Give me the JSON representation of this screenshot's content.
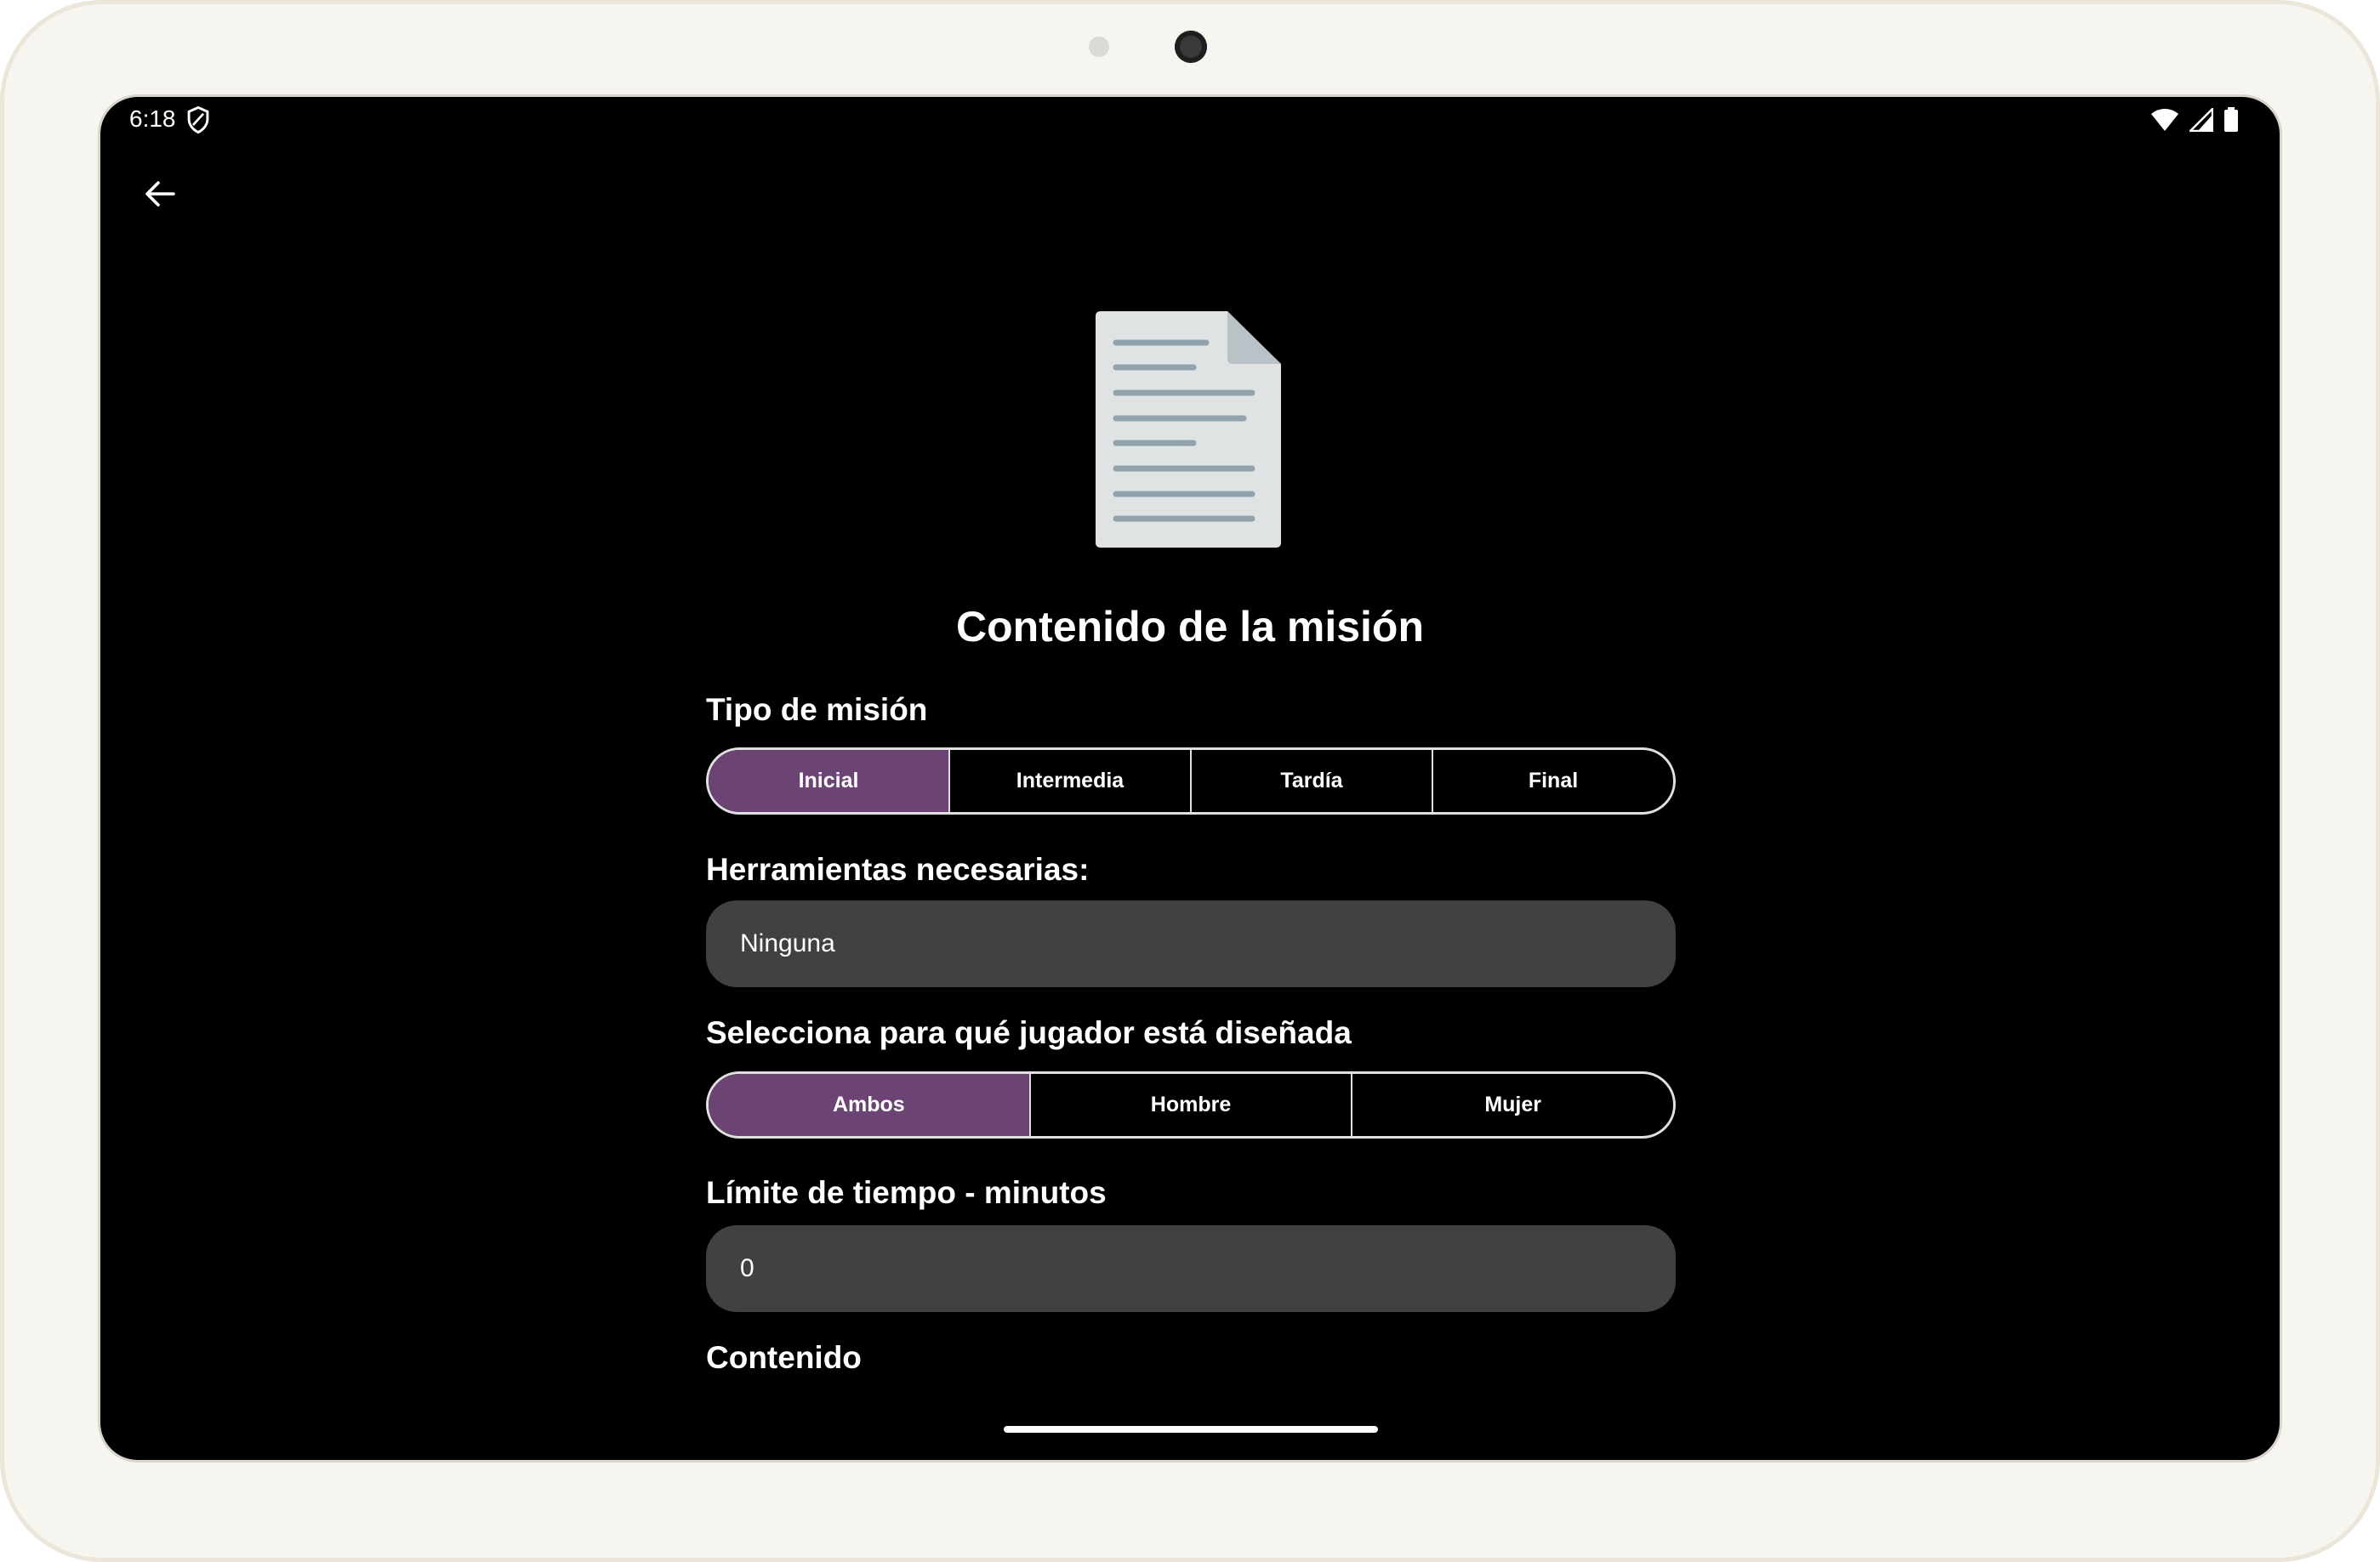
{
  "status_bar": {
    "time": "6:18"
  },
  "header": {
    "title": "Contenido de la misión"
  },
  "mission_type": {
    "label": "Tipo de misión",
    "options": [
      "Inicial",
      "Intermedia",
      "Tardía",
      "Final"
    ],
    "selected": "Inicial"
  },
  "tools": {
    "label": "Herramientas necesarias:",
    "value": "Ninguna"
  },
  "player": {
    "label": "Selecciona para qué jugador está diseñada",
    "options": [
      "Ambos",
      "Hombre",
      "Mujer"
    ],
    "selected": "Ambos"
  },
  "time_limit": {
    "label": "Límite de tiempo - minutos",
    "value": "0"
  },
  "content": {
    "label": "Contenido"
  },
  "colors": {
    "selected_segment": "#6b4474",
    "input_background": "#414141",
    "screen_background": "#000000"
  }
}
